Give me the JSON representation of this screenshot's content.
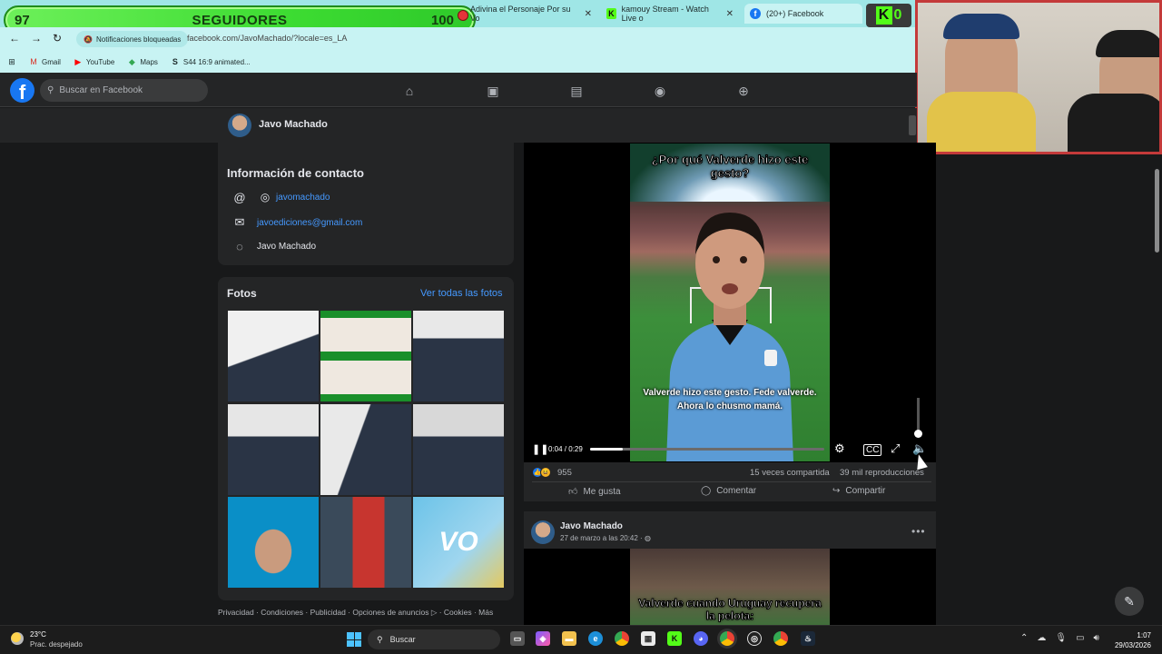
{
  "overlay": {
    "follow_left": "97",
    "follow_label": "SEGUIDORES",
    "follow_right": "100",
    "kick_count": "0"
  },
  "browser": {
    "tabs": [
      {
        "label": "Adivina el Personaje Por su Vo"
      },
      {
        "label": "kamouy Stream - Watch Live o"
      },
      {
        "label": "(20+) Facebook"
      }
    ],
    "notifications": "Notificaciones bloqueadas",
    "url": "facebook.com/JavoMachado/?locale=es_LA",
    "bookmarks": [
      {
        "label": "Gmail"
      },
      {
        "label": "YouTube"
      },
      {
        "label": "Maps"
      },
      {
        "label": "S44 16:9 animated..."
      }
    ]
  },
  "fb": {
    "search_placeholder": "Buscar en Facebook",
    "profile_name": "Javo Machado"
  },
  "contact": {
    "title": "Información de contacto",
    "instagram": "javomachado",
    "email": "javoediciones@gmail.com",
    "messenger": "Javo Machado"
  },
  "photos": {
    "title": "Fotos",
    "see_all": "Ver todas las fotos"
  },
  "footer": "Privacidad · Condiciones · Publicidad · Opciones de anuncios ▷ · Cookies · Más",
  "video": {
    "title": "¿Por qué Valverde hizo este gesto?",
    "subtitle": "Valverde hizo este gesto. Fede valverde. Ahora lo chusmo mamá.",
    "time": "0:04 / 0:29",
    "progress": 0.138,
    "reactions": "955",
    "shares": "15 veces compartida",
    "views": "39 mil reproducciones",
    "like": "Me gusta",
    "comment": "Comentar",
    "share": "Compartir"
  },
  "post2": {
    "author": "Javo Machado",
    "date": "27 de marzo a las 20:42 · ",
    "video_title": "Valverde cuando Uruguay recupera la pelota:"
  },
  "taskbar": {
    "temp": "23°C",
    "weather": "Prac. despejado",
    "search": "Buscar",
    "time": "1:07",
    "date": "29/03/2026"
  }
}
